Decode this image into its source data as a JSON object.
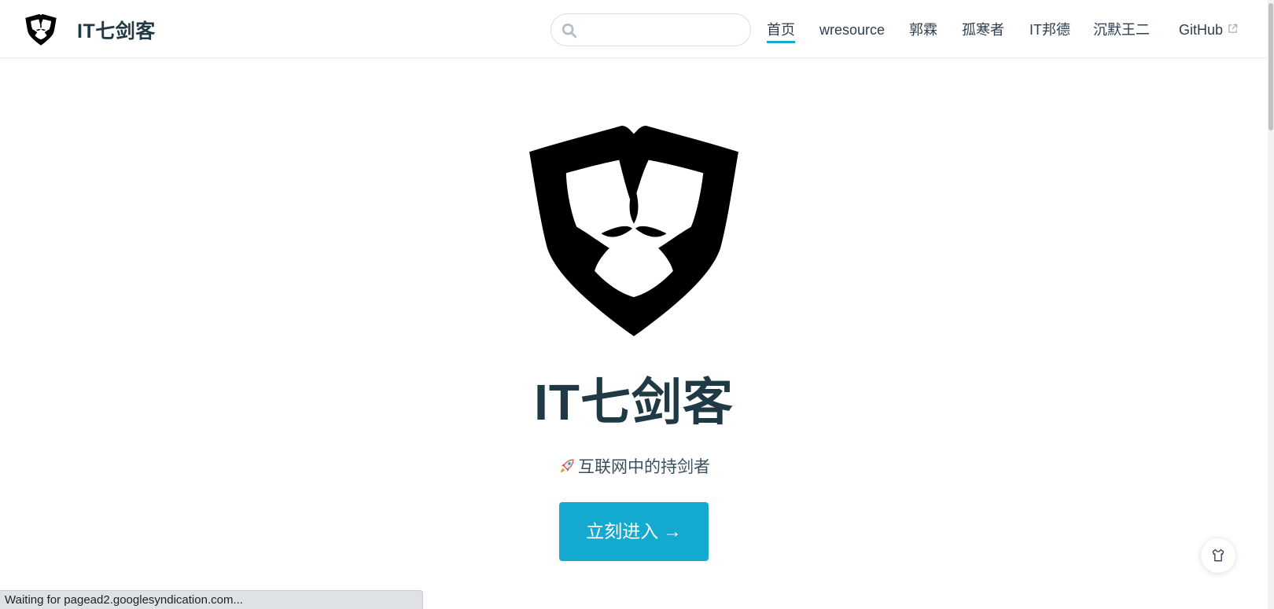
{
  "navbar": {
    "brand_title": "IT七剑客",
    "search": {
      "value": "",
      "placeholder": ""
    },
    "links": [
      {
        "label": "首页",
        "active": true
      },
      {
        "label": "wresource",
        "active": false
      },
      {
        "label": "郭霖",
        "active": false
      },
      {
        "label": "孤寒者",
        "active": false
      },
      {
        "label": "IT邦德",
        "active": false
      },
      {
        "label": "沉默王二",
        "active": false
      },
      {
        "label": "GitHub",
        "active": false,
        "external": true
      }
    ]
  },
  "hero": {
    "title": "IT七剑客",
    "tagline": "互联网中的持剑者",
    "tagline_icon": "rocket-icon",
    "cta_label": "立刻进入 →"
  },
  "theme_toggle": {
    "icon": "shirt-icon"
  },
  "status_bar": {
    "text": "Waiting for pagead2.googlesyndication.com..."
  },
  "colors": {
    "accent": "#14a9cf",
    "text": "#2c3e50",
    "title": "#1f3a44"
  }
}
